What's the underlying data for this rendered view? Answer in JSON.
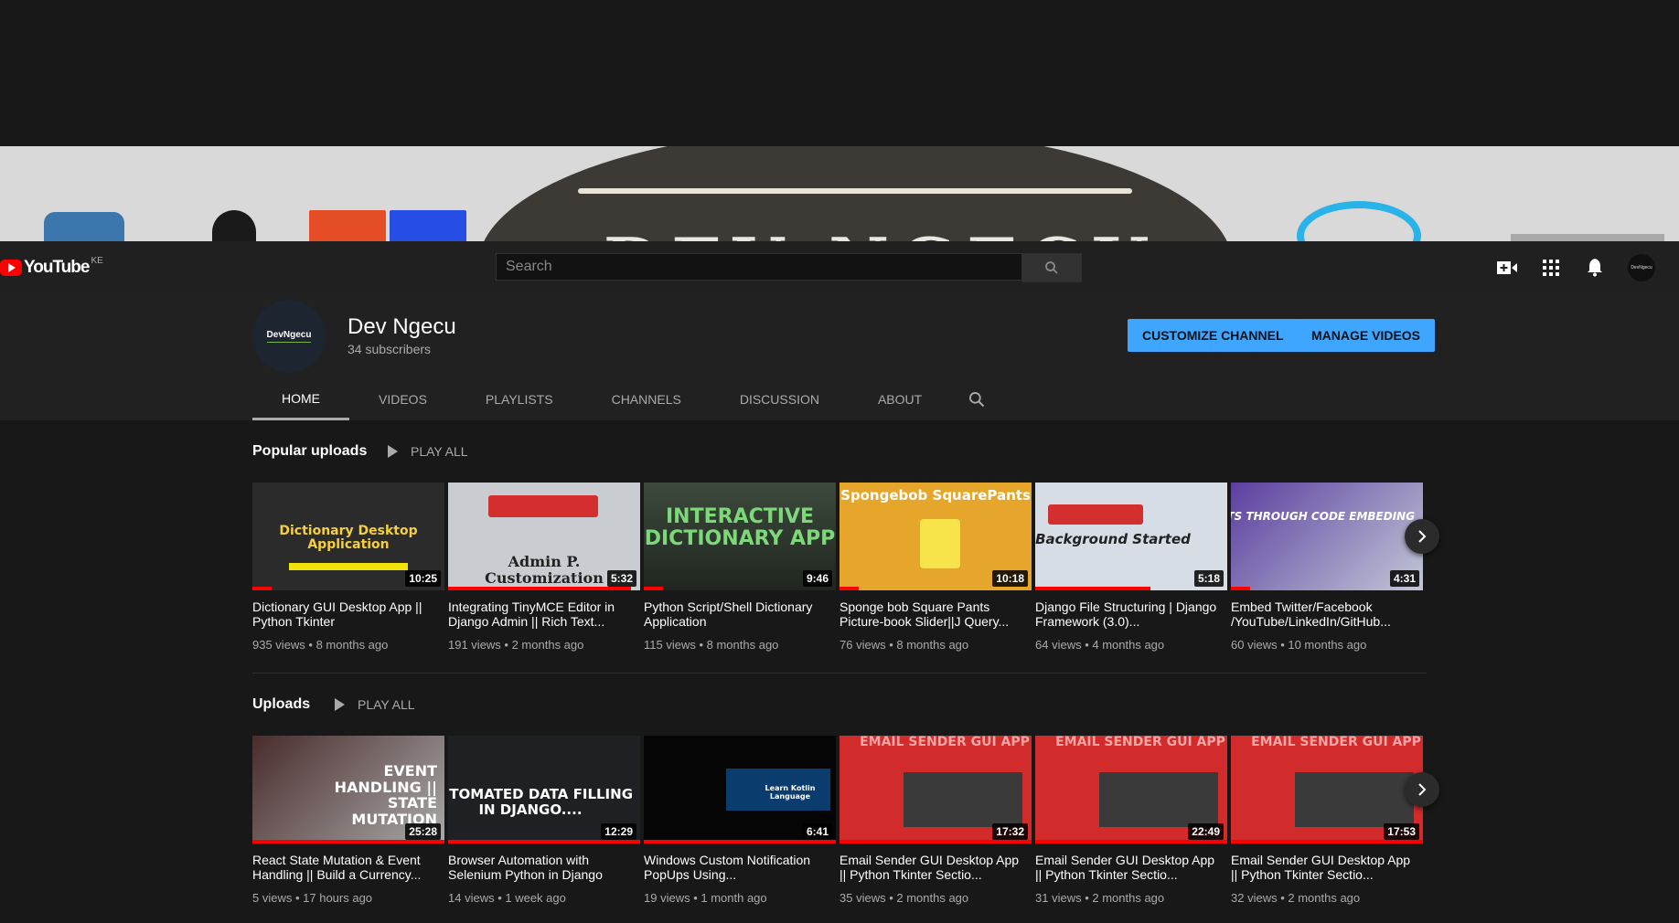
{
  "app": {
    "logo_text": "YouTube",
    "country": "KE"
  },
  "banner": {
    "art_text": "DEV NGECU"
  },
  "search": {
    "placeholder": "Search"
  },
  "channel": {
    "avatar_text": "DevNgecu",
    "name": "Dev Ngecu",
    "subscribers": "34 subscribers",
    "customize_label": "CUSTOMIZE CHANNEL",
    "manage_label": "MANAGE VIDEOS",
    "avatar_sm_text": "DevNgecu"
  },
  "tabs": [
    {
      "label": "HOME"
    },
    {
      "label": "VIDEOS"
    },
    {
      "label": "PLAYLISTS"
    },
    {
      "label": "CHANNELS"
    },
    {
      "label": "DISCUSSION"
    },
    {
      "label": "ABOUT"
    }
  ],
  "popular": {
    "title": "Popular uploads",
    "play_all": "PLAY ALL",
    "videos": [
      {
        "title": "Dictionary GUI Desktop App || Python Tkinter",
        "views": "935 views",
        "age": "8 months ago",
        "duration": "10:25",
        "caption": "Dictionary Desktop Application",
        "progress": 0.1
      },
      {
        "title": "Integrating TinyMCE Editor in Django Admin || Rich Text...",
        "views": "191 views",
        "age": "2 months ago",
        "duration": "5:32",
        "caption": "Admin P. Customization",
        "progress": 0.95
      },
      {
        "title": "Python Script/Shell Dictionary Application",
        "views": "115 views",
        "age": "8 months ago",
        "duration": "9:46",
        "caption": "INTERACTIVE DICTIONARY APP",
        "progress": 0.1
      },
      {
        "title": "Sponge bob Square Pants Picture-book Slider||J Query...",
        "views": "76 views",
        "age": "8 months ago",
        "duration": "10:18",
        "caption": "Spongebob SquarePants",
        "progress": 0.1
      },
      {
        "title": "Django File Structuring | Django Framework (3.0)...",
        "views": "64 views",
        "age": "4 months ago",
        "duration": "5:18",
        "caption": "Background Started",
        "progress": 0.6
      },
      {
        "title": "Embed Twitter/Facebook /YouTube/LinkedIn/GitHub...",
        "views": "60 views",
        "age": "10 months ago",
        "duration": "4:31",
        "caption": "ACCOUNTS THROUGH CODE EMBEDING",
        "progress": 0.1
      }
    ]
  },
  "uploads": {
    "title": "Uploads",
    "play_all": "PLAY ALL",
    "videos": [
      {
        "title": "React State Mutation & Event Handling || Build a Currency...",
        "views": "5 views",
        "age": "17 hours ago",
        "duration": "25:28",
        "caption": "EVENT HANDLING || STATE MUTATION",
        "progress": 1.0
      },
      {
        "title": "Browser Automation with Selenium Python in Django",
        "views": "14 views",
        "age": "1 week ago",
        "duration": "12:29",
        "caption": "AUTOMATED DATA FILLING IN DJANGO....",
        "progress": 1.0
      },
      {
        "title": "Windows Custom Notification PopUps Using...",
        "views": "19 views",
        "age": "1 month ago",
        "duration": "6:41",
        "caption": "Learn Kotlin Language",
        "progress": 1.0
      },
      {
        "title": "Email Sender GUI Desktop App || Python Tkinter Sectio...",
        "views": "35 views",
        "age": "2 months ago",
        "duration": "17:32",
        "caption": "EMAIL SENDER GUI APP",
        "progress": 1.0
      },
      {
        "title": "Email Sender GUI Desktop App || Python Tkinter Sectio...",
        "views": "31 views",
        "age": "2 months ago",
        "duration": "22:49",
        "caption": "EMAIL SENDER GUI APP",
        "progress": 1.0
      },
      {
        "title": "Email Sender GUI Desktop App || Python Tkinter Sectio...",
        "views": "32 views",
        "age": "2 months ago",
        "duration": "17:53",
        "caption": "EMAIL SENDER GUI APP",
        "progress": 1.0
      }
    ]
  },
  "colors": {
    "accent": "#3ea6ff",
    "brand": "#ff0000",
    "background": "#181818"
  },
  "icons": [
    "search-icon",
    "create-video-icon",
    "apps-grid-icon",
    "notifications-bell-icon",
    "play-icon",
    "chevron-right-icon"
  ]
}
